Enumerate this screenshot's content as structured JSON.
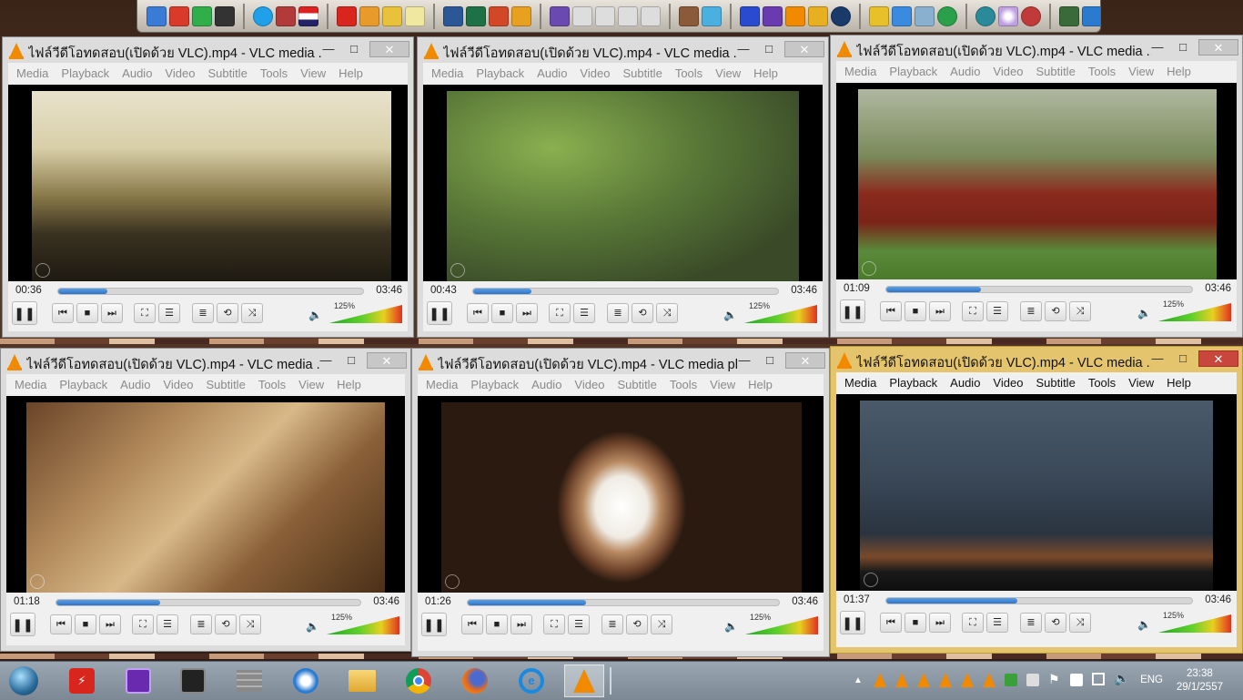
{
  "window_title": "ไฟล์วีดีโอทดสอบ(เปิดด้วย VLC).mp4 - VLC media ...",
  "window_title_alt": "ไฟล์วีดีโอทดสอบ(เปิดด้วย VLC).mp4 - VLC media pl...",
  "menu": [
    "Media",
    "Playback",
    "Audio",
    "Video",
    "Subtitle",
    "Tools",
    "View",
    "Help"
  ],
  "duration": "03:46",
  "volume_label": "125%",
  "players": [
    {
      "elapsed": "00:36",
      "progress": 0.16,
      "scene": "temple-silhouette-sunset",
      "title_key": "window_title"
    },
    {
      "elapsed": "00:43",
      "progress": 0.19,
      "scene": "pink-dragonfly-on-plant",
      "title_key": "window_title"
    },
    {
      "elapsed": "01:09",
      "progress": 0.31,
      "scene": "monks-walking-in-field",
      "title_key": "window_title"
    },
    {
      "elapsed": "01:18",
      "progress": 0.34,
      "scene": "carved-temple-stonework",
      "title_key": "window_title"
    },
    {
      "elapsed": "01:26",
      "progress": 0.38,
      "scene": "brick-tunnel-to-light",
      "title_key": "window_title_alt"
    },
    {
      "elapsed": "01:37",
      "progress": 0.43,
      "scene": "dusk-cloudy-sky",
      "title_key": "window_title"
    }
  ],
  "controls": {
    "pause": "❚❚",
    "prev": "⏮",
    "stop": "■",
    "next": "⏭",
    "fullscreen": "⛶",
    "extended": "☰",
    "playlist": "≣",
    "loop": "⟲",
    "shuffle": "⤨",
    "volume": "🔈",
    "close": "✕",
    "minimize": "—",
    "maximize": "□"
  },
  "taskbar": {
    "apps": [
      "start-orb-icon",
      "flash-app-icon",
      "cpuz-app-icon",
      "screen-app-icon",
      "firewall-app-icon",
      "network-app-icon",
      "file-explorer-icon",
      "chrome-icon",
      "firefox-icon",
      "internet-explorer-icon",
      "vlc-icon"
    ],
    "language": "ENG",
    "time": "23:38",
    "date": "29/1/2557"
  }
}
